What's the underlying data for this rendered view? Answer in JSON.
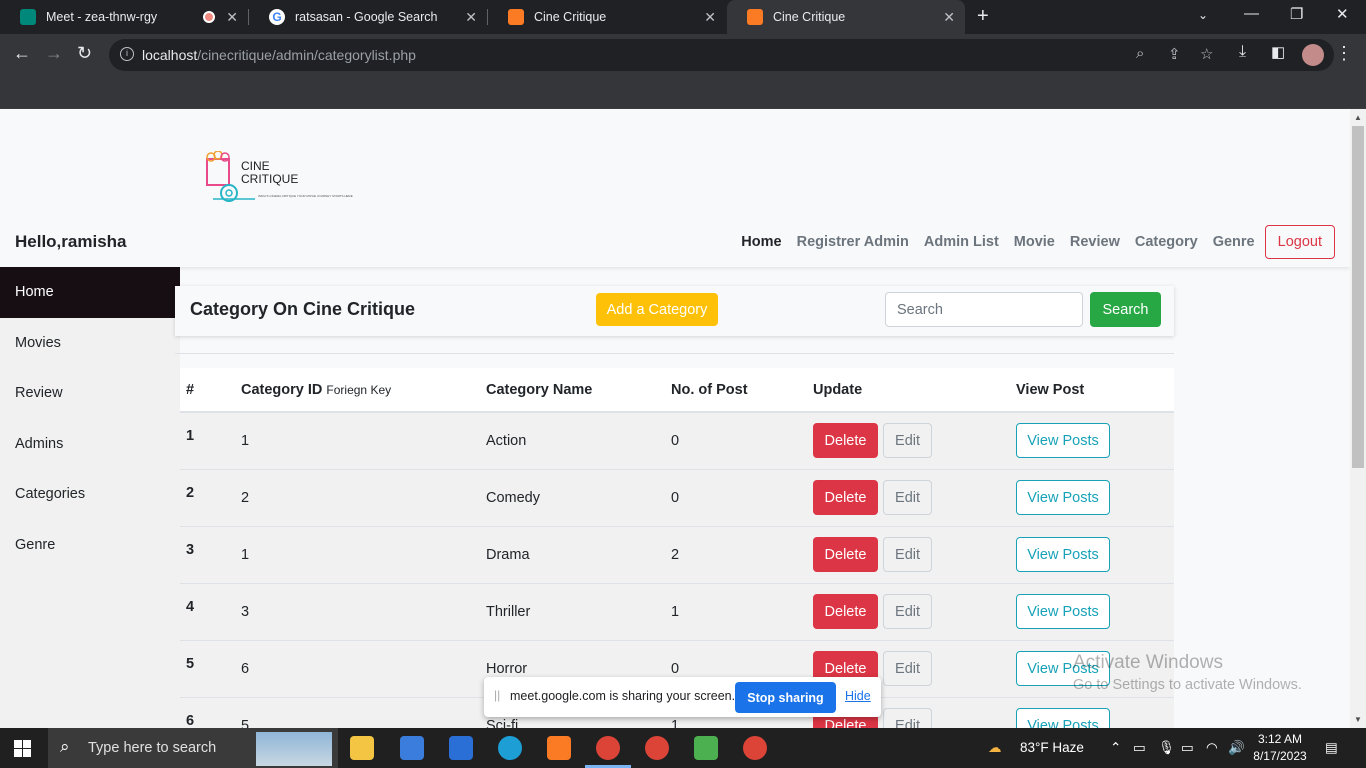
{
  "browser": {
    "tabs": [
      {
        "title": "Meet - zea-thnw-rgy",
        "active": false
      },
      {
        "title": "ratsasan - Google Search",
        "active": false
      },
      {
        "title": "Cine Critique",
        "active": false
      },
      {
        "title": "Cine Critique",
        "active": true
      }
    ],
    "url_host": "localhost",
    "url_path": "/cinecritique/admin/categorylist.php"
  },
  "logo": {
    "line1": "CINE",
    "line2": "CRITIQUE",
    "tagline": "INDIA'S CINEMA CRITIQUE YOUR MOVIE JOURNEY STARTS HERE"
  },
  "navbar": {
    "greeting": "Hello,ramisha",
    "links": [
      "Home",
      "Registrer Admin",
      "Admin List",
      "Movie",
      "Review",
      "Category",
      "Genre"
    ],
    "logout": "Logout"
  },
  "sidebar": {
    "items": [
      "Home",
      "Movies",
      "Review",
      "Admins",
      "Categories",
      "Genre"
    ]
  },
  "header": {
    "title": "Category On Cine Critique",
    "add_button": "Add a Category",
    "search_placeholder": "Search",
    "search_button": "Search"
  },
  "table": {
    "columns": {
      "num": "#",
      "category_id": "Category ID",
      "category_id_note": "Foriegn Key",
      "name": "Category Name",
      "posts": "No. of Post",
      "update": "Update",
      "view": "View Post"
    },
    "buttons": {
      "delete": "Delete",
      "edit": "Edit",
      "view": "View Posts"
    },
    "rows": [
      {
        "num": "1",
        "category_id": "1",
        "name": "Action",
        "posts": "0"
      },
      {
        "num": "2",
        "category_id": "2",
        "name": "Comedy",
        "posts": "0"
      },
      {
        "num": "3",
        "category_id": "1",
        "name": "Drama",
        "posts": "2"
      },
      {
        "num": "4",
        "category_id": "3",
        "name": "Thriller",
        "posts": "1"
      },
      {
        "num": "5",
        "category_id": "6",
        "name": "Horror",
        "posts": "0"
      },
      {
        "num": "6",
        "category_id": "5",
        "name": "Sci-fi",
        "posts": "1"
      }
    ]
  },
  "share_bar": {
    "text": "meet.google.com is sharing your screen.",
    "stop": "Stop sharing",
    "hide": "Hide"
  },
  "watermark": {
    "line1": "Activate Windows",
    "line2": "Go to Settings to activate Windows."
  },
  "taskbar": {
    "search_placeholder": "Type here to search",
    "weather": "83°F  Haze",
    "time": "3:12 AM",
    "date": "8/17/2023"
  },
  "colors": {
    "danger": "#dc3545",
    "warning": "#ffc107",
    "success": "#28a745",
    "info": "#17a2b8",
    "sidebar_active": "#170e14"
  }
}
